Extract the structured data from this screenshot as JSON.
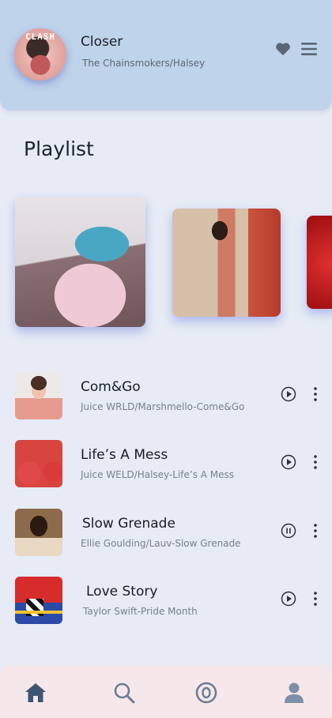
{
  "now_playing": {
    "title": "Closer",
    "artist": "The Chainsmokers/Halsey",
    "cover_text": "CLASH"
  },
  "playlist": {
    "heading": "Playlist"
  },
  "songs": [
    {
      "title": "Com&Go",
      "subtitle": "Juice WRLD/Marshmello-Come&Go",
      "state": "play"
    },
    {
      "title": "Life’s A Mess",
      "subtitle": "Juice WELD/Halsey-Life’s  A Mess",
      "state": "play"
    },
    {
      "title": "Slow Grenade",
      "subtitle": "Ellie Goulding/Lauv-Slow Grenade",
      "state": "pause"
    },
    {
      "title": "Love Story",
      "subtitle": "Taylor Swift-Pride Month",
      "state": "play"
    }
  ],
  "nav": {
    "items": [
      "home-icon",
      "search-icon",
      "discover-icon",
      "profile-icon"
    ],
    "active_color": "#3f5574"
  },
  "colors": {
    "background": "#e6ebf5",
    "header": "#bfd3ea",
    "bottom_nav": "#f6e8ea",
    "icon": "#5b6577"
  }
}
